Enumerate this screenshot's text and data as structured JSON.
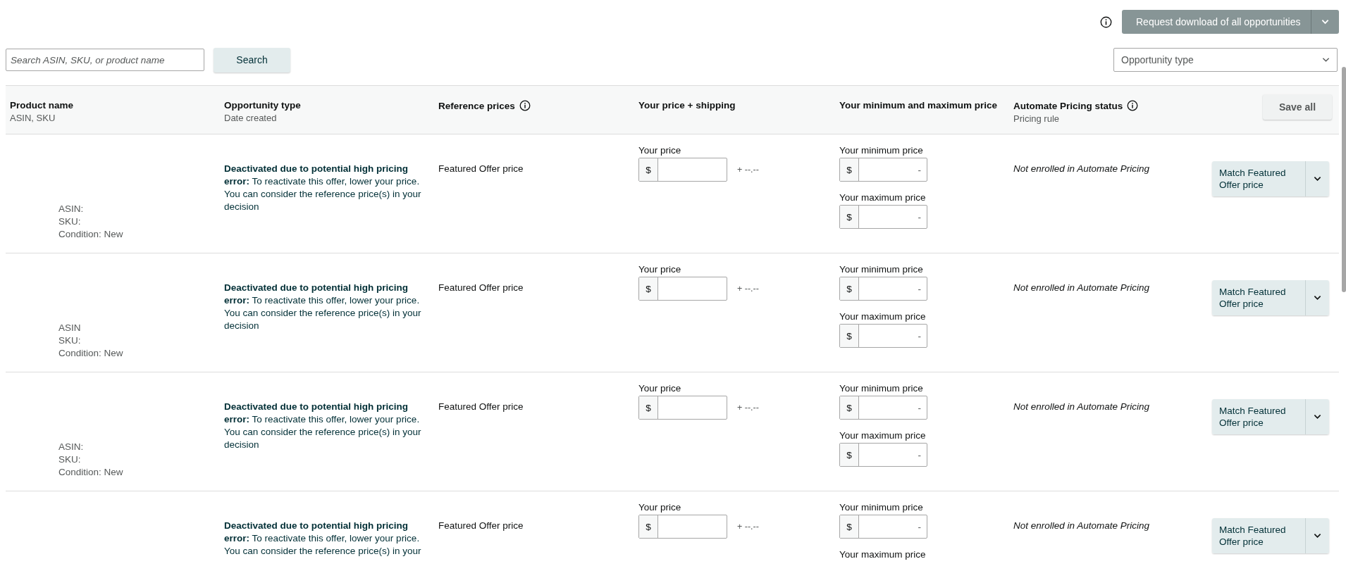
{
  "toolbar": {
    "download_button": "Request download of all opportunities"
  },
  "search": {
    "placeholder": "Search ASIN, SKU, or product name",
    "button": "Search"
  },
  "filter": {
    "placeholder": "Opportunity type"
  },
  "table": {
    "columns": [
      {
        "title": "Product name",
        "subtitle": "ASIN, SKU"
      },
      {
        "title": "Opportunity type",
        "subtitle": "Date created"
      },
      {
        "title": "Reference prices",
        "info": true
      },
      {
        "title": "Your price + shipping"
      },
      {
        "title": "Your minimum and maximum price"
      },
      {
        "title": "Automate Pricing status",
        "subtitle": "Pricing rule",
        "info": true
      }
    ],
    "save_all": "Save all",
    "rows": [
      {
        "product_lines": [
          "ASIN:",
          "SKU:",
          "Condition: New"
        ],
        "message": "**Deactivated due to potential high pricing error:** To reactivate this offer, lower your price. You can consider the reference price(s) in your decision",
        "reference": "Featured Offer price",
        "price_label": "Your price",
        "currency": "$",
        "shipping": "+ --.--",
        "min_label": "Your minimum price",
        "min_currency": "$",
        "min_value": "-",
        "max_label": "Your maximum price",
        "max_currency": "$",
        "max_value": "-",
        "status": "Not enrolled in Automate Pricing",
        "action": "Match Featured Offer price"
      },
      {
        "product_lines": [
          "ASIN",
          "SKU:",
          "Condition: New"
        ],
        "message": "**Deactivated due to potential high pricing error:** To reactivate this offer, lower your price. You can consider the reference price(s) in your decision",
        "reference": "Featured Offer price",
        "price_label": "Your price",
        "currency": "$",
        "shipping": "+ --.--",
        "min_label": "Your minimum price",
        "min_currency": "$",
        "min_value": "-",
        "max_label": "Your maximum price",
        "max_currency": "$",
        "max_value": "-",
        "status": "Not enrolled in Automate Pricing",
        "action": "Match Featured Offer price"
      },
      {
        "product_lines": [
          "ASIN:",
          "SKU:",
          "Condition: New"
        ],
        "message": "**Deactivated due to potential high pricing error:** To reactivate this offer, lower your price. You can consider the reference price(s) in your decision",
        "reference": "Featured Offer price",
        "price_label": "Your price",
        "currency": "$",
        "shipping": "+ --.--",
        "min_label": "Your minimum price",
        "min_currency": "$",
        "min_value": "-",
        "max_label": "Your maximum price",
        "max_currency": "$",
        "max_value": "-",
        "status": "Not enrolled in Automate Pricing",
        "action": "Match Featured Offer price"
      },
      {
        "message": "**Deactivated due to potential high pricing error:** To reactivate this offer, lower your price. You can consider the reference price(s) in your",
        "reference": "Featured Offer price",
        "price_label": "Your price",
        "currency": "$",
        "shipping": "+ --.--",
        "min_label": "Your minimum price",
        "min_currency": "$",
        "min_value": "-",
        "max_label": "Your maximum price",
        "status": "Not enrolled in Automate Pricing",
        "action": "Match Featured Offer price"
      }
    ]
  }
}
